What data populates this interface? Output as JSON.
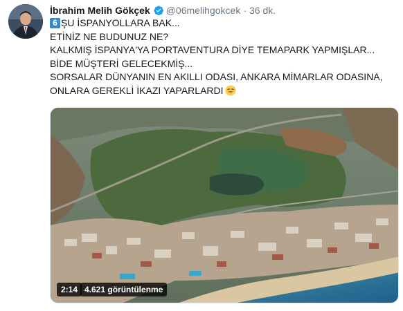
{
  "author": {
    "display_name": "İbrahim Melih Gökçek",
    "handle": "@06melihgokcek",
    "separator": "·",
    "timestamp": "36 dk.",
    "avatar_icon": "profile-photo",
    "verified_icon": "verified-badge-icon"
  },
  "tweet": {
    "keycap_digit": "6",
    "lines": [
      "ŞU İSPANYOLLARA BAK...",
      "ETİNİZ NE BUDUNUZ NE?",
      "KALKMIŞ İSPANYA'YA PORTAVENTURA DİYE TEMAPARK YAPMIŞLAR...",
      "BİDE MÜŞTERİ GELECEKMİŞ...",
      "SORSALAR DÜNYANIN EN AKILLI ODASI, ANKARA MİMARLAR ODASINA,",
      "ONLARA GEREKLİ İKAZI YAPARLARDI"
    ],
    "trailing_emoji": "grinning-sweat-emoji"
  },
  "media": {
    "duration": "2:14",
    "views": "4.621 görüntülenme"
  },
  "colors": {
    "text": "#14171a",
    "secondary": "#657786",
    "verified": "#1da1f2",
    "keycap": "#3b88c3"
  }
}
